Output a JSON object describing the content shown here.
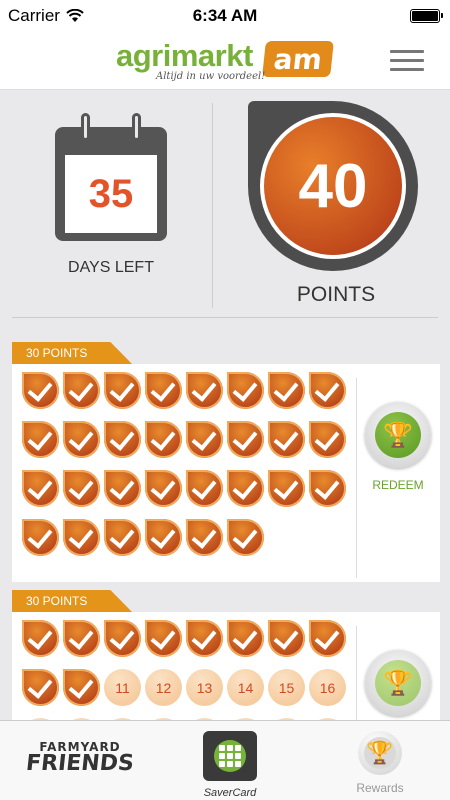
{
  "status_bar": {
    "carrier": "Carrier",
    "time": "6:34 AM"
  },
  "header": {
    "logo_text": "agrimarkt",
    "logo_badge": "am",
    "logo_tagline": "Altijd in uw voordeel!",
    "menu_icon": "hamburger-menu-icon"
  },
  "summary": {
    "days_left_value": "35",
    "days_left_label": "DAYS LEFT",
    "points_value": "40",
    "points_label": "POINTS"
  },
  "cards": [
    {
      "title": "30 POINTS",
      "total_stamps": 30,
      "completed": 30,
      "redeem_label": "REDEEM"
    },
    {
      "title": "30 POINTS",
      "total_stamps": 30,
      "completed": 10,
      "visible_numbers": [
        "11",
        "12",
        "13",
        "14",
        "15",
        "16"
      ]
    }
  ],
  "tabbar": {
    "farmyard_top": "FARMYARD",
    "farmyard_bottom": "FRIENDS",
    "saver_label": "SaverCard",
    "rewards_label": "Rewards"
  },
  "colors": {
    "green": "#78b13a",
    "orange": "#e28a1a",
    "stamp": "#c14a1c",
    "tab": "#e39419"
  }
}
